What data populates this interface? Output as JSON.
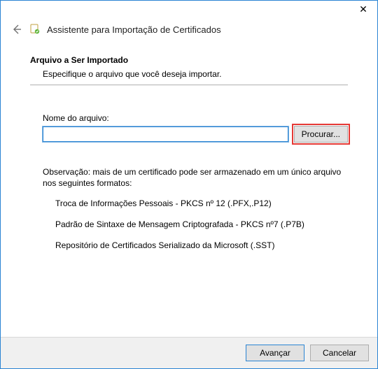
{
  "titlebar": {
    "close_glyph": "✕"
  },
  "header": {
    "title": "Assistente para Importação de Certificados"
  },
  "section": {
    "heading": "Arquivo a Ser Importado",
    "description": "Especifique o arquivo que você deseja importar."
  },
  "file_field": {
    "label": "Nome do arquivo:",
    "value": "",
    "browse_label": "Procurar..."
  },
  "note": "Observação: mais de um certificado pode ser armazenado em um único arquivo nos seguintes formatos:",
  "formats": [
    "Troca de Informações Pessoais - PKCS nº 12 (.PFX,.P12)",
    "Padrão de Sintaxe de Mensagem Criptografada - PKCS nº7 (.P7B)",
    "Repositório de Certificados Serializado da Microsoft (.SST)"
  ],
  "footer": {
    "next_label": "Avançar",
    "cancel_label": "Cancelar"
  }
}
